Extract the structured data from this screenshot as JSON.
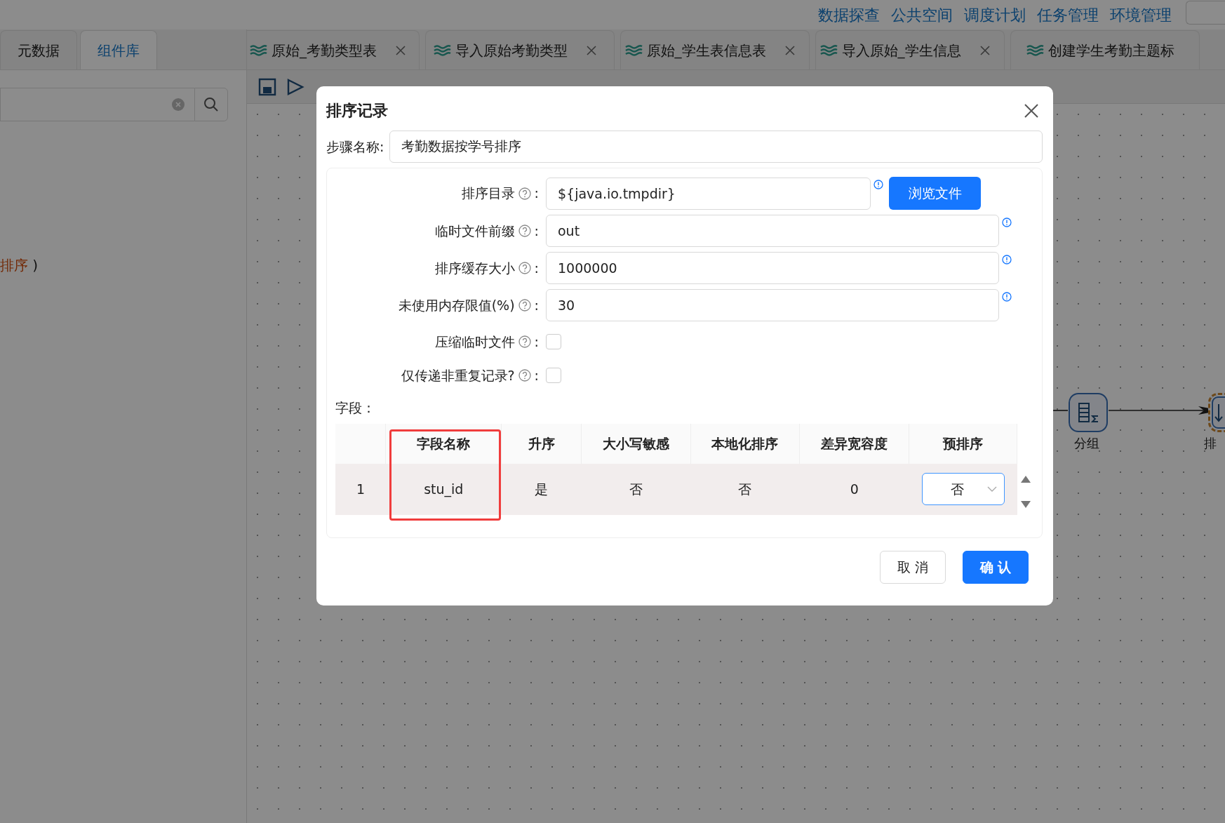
{
  "top_nav": [
    {
      "label": "数据探查"
    },
    {
      "label": "公共空间"
    },
    {
      "label": "调度计划"
    },
    {
      "label": "任务管理"
    },
    {
      "label": "环境管理"
    }
  ],
  "side_tabs": [
    {
      "label": "元数据",
      "selected": false
    },
    {
      "label": "组件库",
      "selected": true
    }
  ],
  "side_snippet": {
    "highlight": "排序",
    "rest": ")"
  },
  "editor_tabs": [
    {
      "label": "原始_考勤类型表",
      "closable": true
    },
    {
      "label": "导入原始考勤类型",
      "closable": true
    },
    {
      "label": "原始_学生表信息表",
      "closable": true
    },
    {
      "label": "导入原始_学生信息",
      "closable": true
    },
    {
      "label": "创建学生考勤主题标",
      "closable": false
    }
  ],
  "canvas": {
    "nodes": [
      {
        "label": "分组",
        "kind": "group",
        "selected": false
      },
      {
        "label": "排",
        "kind": "sort",
        "selected": true
      }
    ]
  },
  "dialog": {
    "title": "排序记录",
    "step_name": {
      "label": "步骤名称:",
      "value": "考勤数据按学号排序"
    },
    "fields": [
      {
        "kind": "text",
        "label": "排序目录",
        "suffix": ":",
        "value": "${java.io.tmpdir}",
        "info": true,
        "button": "浏览文件"
      },
      {
        "kind": "text",
        "label": "临时文件前缀",
        "suffix": ":",
        "value": "out",
        "info": true
      },
      {
        "kind": "text",
        "label": "排序缓存大小",
        "suffix": ":",
        "value": "1000000",
        "info": true
      },
      {
        "kind": "text",
        "label": "未使用内存限值(%)",
        "suffix": ":",
        "value": "30",
        "info": true
      },
      {
        "kind": "checkbox",
        "label": "压缩临时文件",
        "suffix": ":",
        "checked": false
      },
      {
        "kind": "checkbox",
        "label": "仅传递非重复记录?",
        "suffix": ":",
        "checked": false
      }
    ],
    "table_label": "字段：",
    "table": {
      "columns": [
        {
          "label": "字段名称",
          "highlighted": true
        },
        {
          "label": "升序",
          "highlighted": false
        },
        {
          "label": "大小写敏感",
          "highlighted": false
        },
        {
          "label": "本地化排序",
          "highlighted": false
        },
        {
          "label": "差异宽容度",
          "highlighted": false
        },
        {
          "label": "预排序",
          "highlighted": false
        }
      ],
      "rows": [
        {
          "index": "1",
          "cells": [
            "stu_id",
            "是",
            "否",
            "否",
            "0"
          ],
          "pre_sort": "否"
        }
      ]
    },
    "buttons": [
      {
        "label": "取 消",
        "kind": "secondary"
      },
      {
        "label": "确 认",
        "kind": "primary"
      }
    ]
  }
}
